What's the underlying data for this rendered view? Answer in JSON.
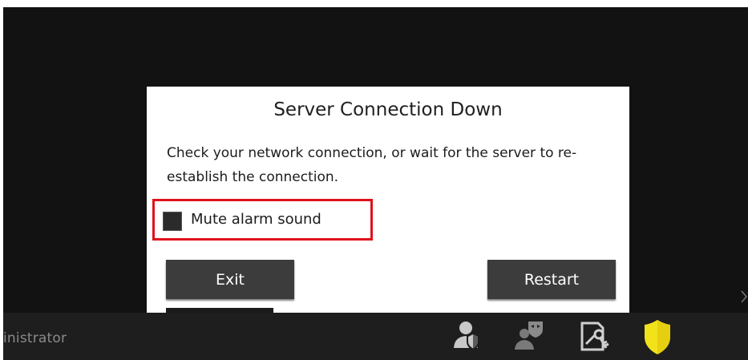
{
  "dialog": {
    "title": "Server Connection Down",
    "message": "Check your network connection, or wait for the server to re-establish the connection.",
    "mute_label": "Mute alarm sound",
    "mute_checked": false,
    "exit_label": "Exit",
    "restart_label": "Restart",
    "highlight_color": "#e0111d"
  },
  "taskbar": {
    "user_name": "inistrator",
    "icons": [
      "user-admin-icon",
      "user-masked-icon",
      "key-edit-icon",
      "shield-icon"
    ],
    "shield_color": "#f2e21a"
  }
}
